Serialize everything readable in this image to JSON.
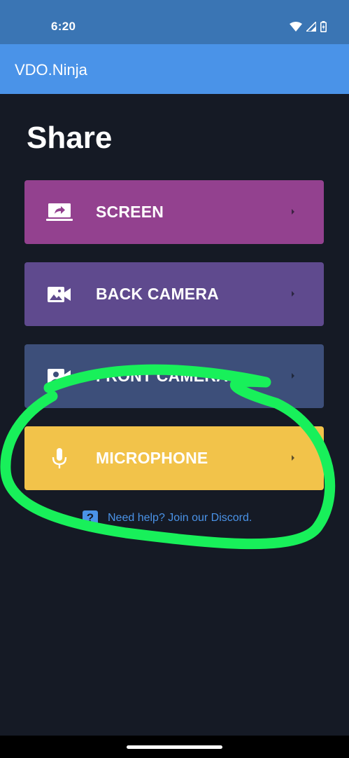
{
  "status_bar": {
    "time": "6:20",
    "icons": [
      "wifi-icon",
      "cell-signal-icon",
      "battery-icon"
    ]
  },
  "app_bar": {
    "title": "VDO.Ninja"
  },
  "main": {
    "title": "Share",
    "cards": [
      {
        "label": "SCREEN",
        "icon": "screen-share-icon",
        "color": "#93418f"
      },
      {
        "label": "BACK CAMERA",
        "icon": "camera-icon",
        "color": "#5f4a8e"
      },
      {
        "label": "FRONT CAMERA",
        "icon": "video-camera-icon",
        "color": "#3d4f7a"
      },
      {
        "label": "MICROPHONE",
        "icon": "microphone-icon",
        "color": "#f2c34a"
      }
    ],
    "help": {
      "icon_glyph": "?",
      "text": "Need help? Join our Discord."
    }
  },
  "colors": {
    "status_bar": "#3a75b4",
    "app_bar": "#4a93e8",
    "background": "#151a25",
    "annotation": "#18f05a"
  }
}
